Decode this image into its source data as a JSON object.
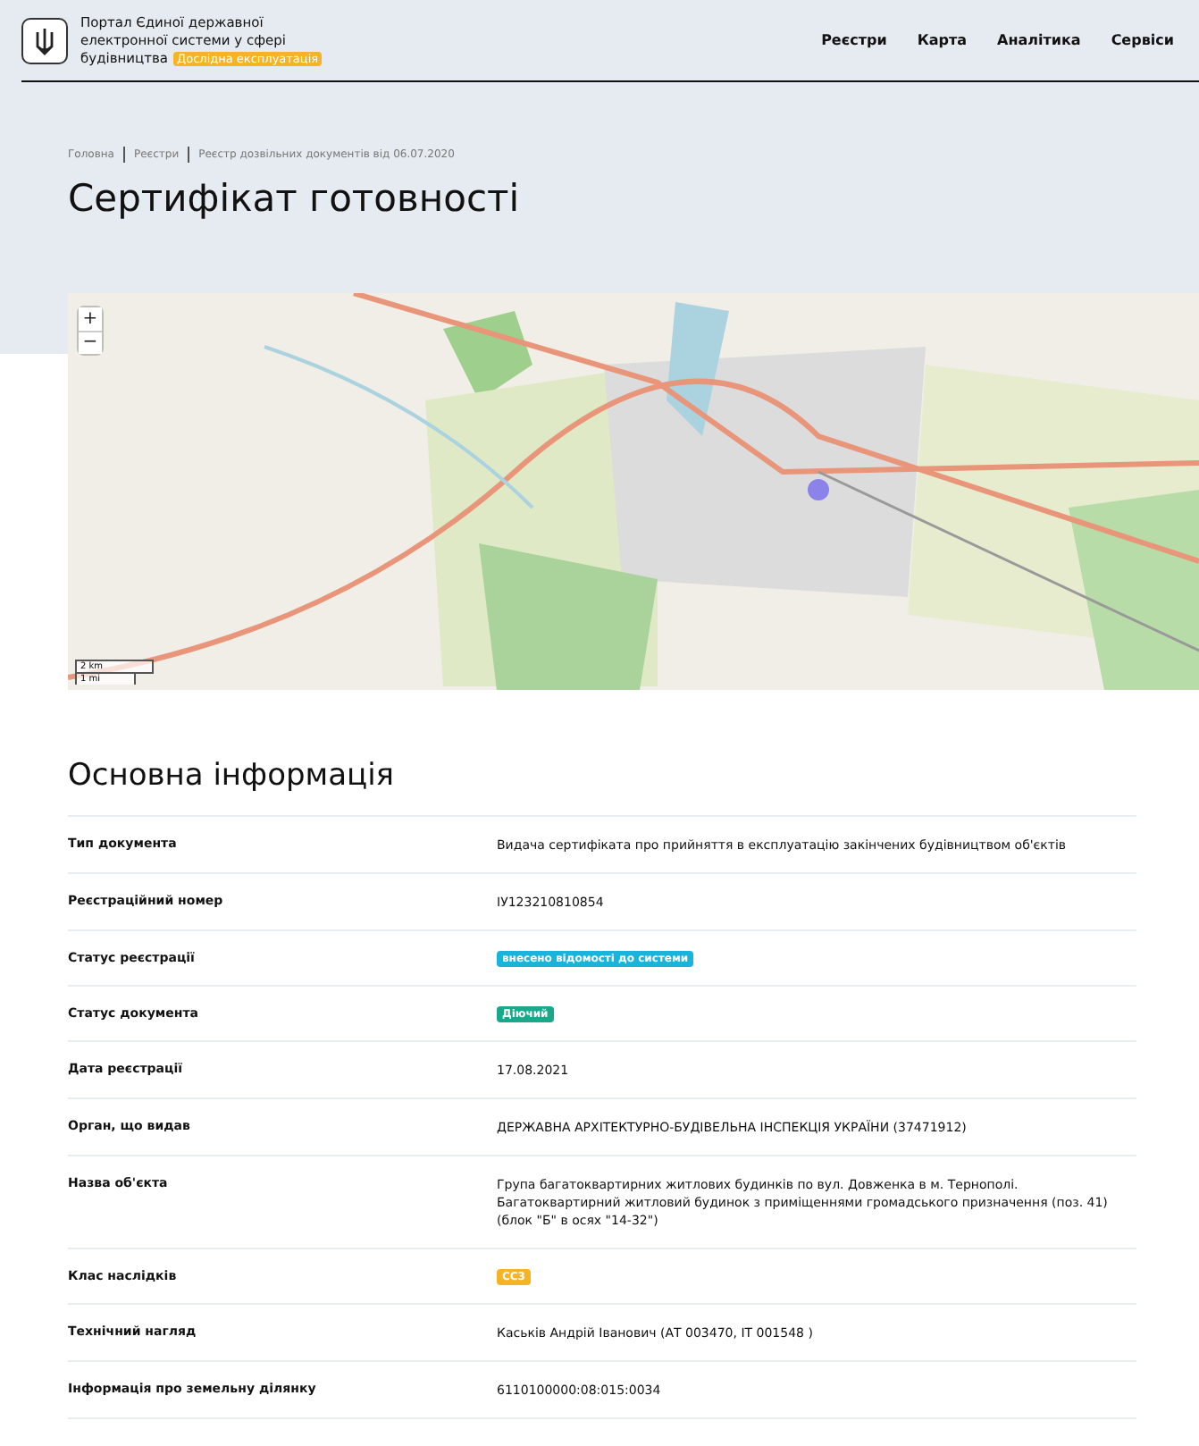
{
  "header": {
    "portal_title": "Портал Єдиної державної електронної системи у сфері будівництва",
    "beta_badge": "Дослідна експлуатація",
    "nav": [
      "Реєстри",
      "Карта",
      "Аналітика",
      "Сервіси"
    ]
  },
  "breadcrumbs": [
    "Головна",
    "Реєстри",
    "Реєстр дозвільних документів від 06.07.2020"
  ],
  "page_title": "Сертифікат готовності",
  "map": {
    "zoom_in": "+",
    "zoom_out": "−",
    "scale": [
      "2 km",
      "1 mi"
    ]
  },
  "section_title": "Основна інформація",
  "rows": [
    {
      "label": "Тип документа",
      "kind": "text",
      "value": "Видача сертифіката про прийняття в експлуатацію закінчених будівництвом об'єктів"
    },
    {
      "label": "Реєстраційний номер",
      "kind": "text",
      "value": "ІУ123210810854"
    },
    {
      "label": "Статус реєстрації",
      "kind": "badge",
      "value": "внесено відомості до системи",
      "color": "#1ab3dc"
    },
    {
      "label": "Статус документа",
      "kind": "badge",
      "value": "Діючий",
      "color": "#1aa88a"
    },
    {
      "label": "Дата реєстрації",
      "kind": "text",
      "value": "17.08.2021"
    },
    {
      "label": "Орган, що видав",
      "kind": "text",
      "value": "ДЕРЖАВНА АРХІТЕКТУРНО-БУДІВЕЛЬНА ІНСПЕКЦІЯ УКРАЇНИ (37471912)"
    },
    {
      "label": "Назва об'єкта",
      "kind": "text",
      "value": "Група багатоквартирних житлових будинків по вул. Довженка в м. Тернополі. Багатоквартирний житловий будинок з приміщеннями громадського призначення (поз. 41) (блок \"Б\" в осях \"14-32\")"
    },
    {
      "label": "Клас наслідків",
      "kind": "badge",
      "value": "СС3",
      "color": "#f5b325"
    },
    {
      "label": "Технічний нагляд",
      "kind": "text",
      "value": "Каськів Андрій Іванович (АТ 003470, ІТ 001548 )"
    },
    {
      "label": "Інформація про земельну ділянку",
      "kind": "text",
      "value": "6110100000:08:015:0034"
    }
  ]
}
